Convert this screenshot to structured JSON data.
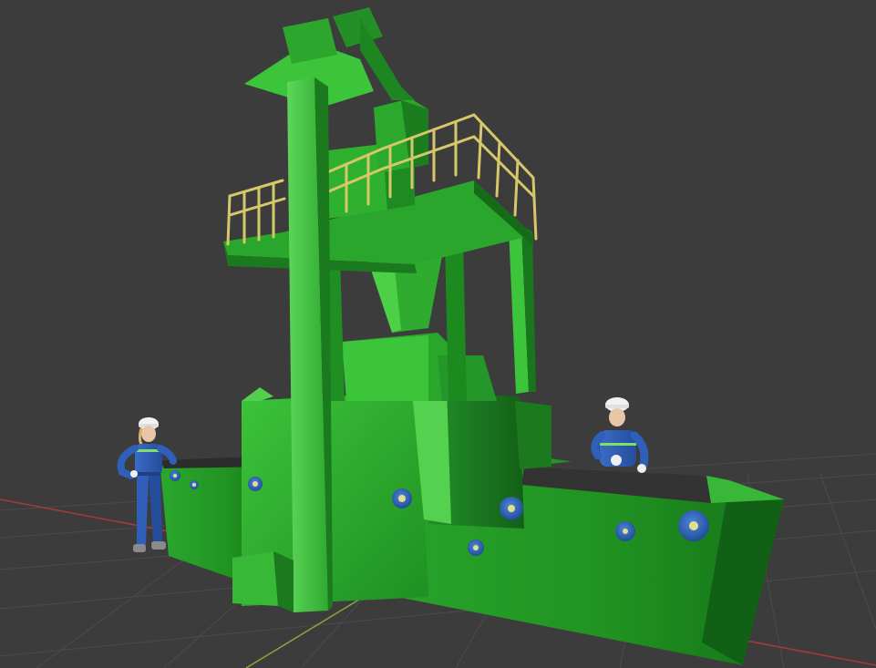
{
  "viewport": {
    "background": "#3c3c3c",
    "grid_line_color": "#4a4a4a",
    "axis_x_color": "#b23a3a",
    "axis_y_color": "#7a9a3a"
  },
  "scene": {
    "machine": {
      "body_color": "#2fae2f",
      "body_light": "#4fd24a",
      "body_dark": "#1b7d1f",
      "body_shadow": "#136015",
      "railing_color": "#d8c96a",
      "conveyor_color": "#3a3a3a",
      "bolt_color": "#2a62b8",
      "bolt_center": "#d9d98a"
    },
    "workers": [
      {
        "name": "worker-left",
        "helmet_color": "#f2f2f2",
        "suit_color": "#2f5fb8",
        "stripe_color": "#7ee06b"
      },
      {
        "name": "worker-right",
        "helmet_color": "#f2f2f2",
        "suit_color": "#2f5fb8",
        "stripe_color": "#7ee06b"
      }
    ]
  }
}
